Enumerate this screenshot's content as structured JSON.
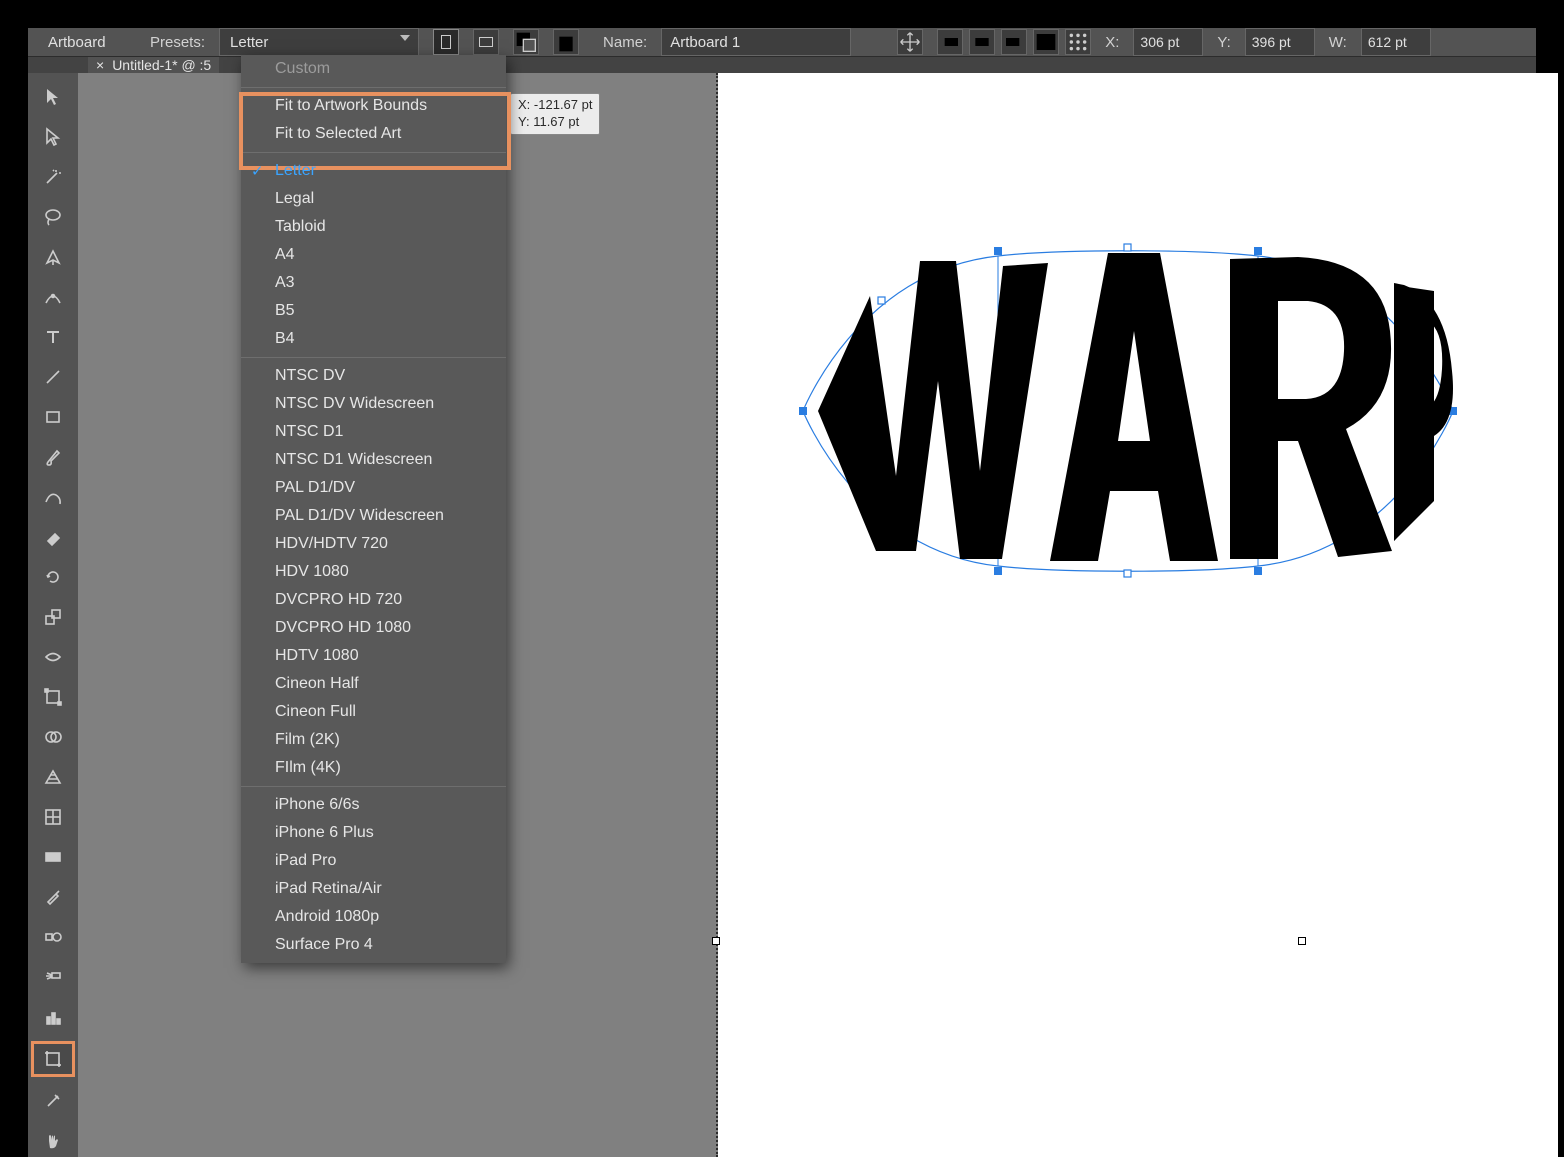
{
  "artboard_bar": {
    "title": "Artboard",
    "presets_label": "Presets:",
    "preset_selected": "Letter",
    "name_label": "Name:",
    "name_value": "Artboard 1",
    "x_label": "X:",
    "x_value": "306 pt",
    "y_label": "Y:",
    "y_value": "396 pt",
    "w_label": "W:",
    "w_value": "612 pt"
  },
  "tab": {
    "label": "Untitled-1* @ :5",
    "close_glyph": "×"
  },
  "cursor_tip": {
    "x_label": "X:",
    "x_value": "-121.67 pt",
    "y_label": "Y:",
    "y_value": "11.67 pt"
  },
  "dropdown": {
    "highlighted_items": [
      "Fit to Artwork Bounds",
      "Fit to Selected Art"
    ],
    "custom": "Custom",
    "selected": "Letter",
    "paper": [
      "Letter",
      "Legal",
      "Tabloid",
      "A4",
      "A3",
      "B5",
      "B4"
    ],
    "video": [
      "NTSC DV",
      "NTSC DV Widescreen",
      "NTSC D1",
      "NTSC D1 Widescreen",
      "PAL D1/DV",
      "PAL D1/DV Widescreen",
      "HDV/HDTV 720",
      "HDV 1080",
      "DVCPRO HD 720",
      "DVCPRO HD 1080",
      "HDTV 1080",
      "Cineon Half",
      "Cineon Full",
      "Film (2K)",
      "FIlm (4K)"
    ],
    "device": [
      "iPhone 6/6s",
      "iPhone 6 Plus",
      "iPad Pro",
      "iPad Retina/Air",
      "Android 1080p",
      "Surface Pro 4"
    ]
  },
  "art_text": "WARP",
  "colors": {
    "highlight_box": "#e8915f",
    "selected_text": "#3aa4ff",
    "selection_outline": "#2a7de1"
  },
  "toolbar": {
    "tools": [
      "selection-tool",
      "direct-selection-tool",
      "magic-wand-tool",
      "lasso-tool",
      "pen-tool",
      "curvature-tool",
      "type-tool",
      "line-tool",
      "rectangle-tool",
      "paintbrush-tool",
      "pencil-tool",
      "eraser-tool",
      "rotate-tool",
      "scale-tool",
      "width-tool",
      "free-transform-tool",
      "shape-builder-tool",
      "perspective-grid-tool",
      "mesh-tool",
      "gradient-tool",
      "eyedropper-tool",
      "blend-tool",
      "symbol-sprayer-tool",
      "column-graph-tool",
      "artboard-tool",
      "slice-tool",
      "hand-tool"
    ]
  }
}
